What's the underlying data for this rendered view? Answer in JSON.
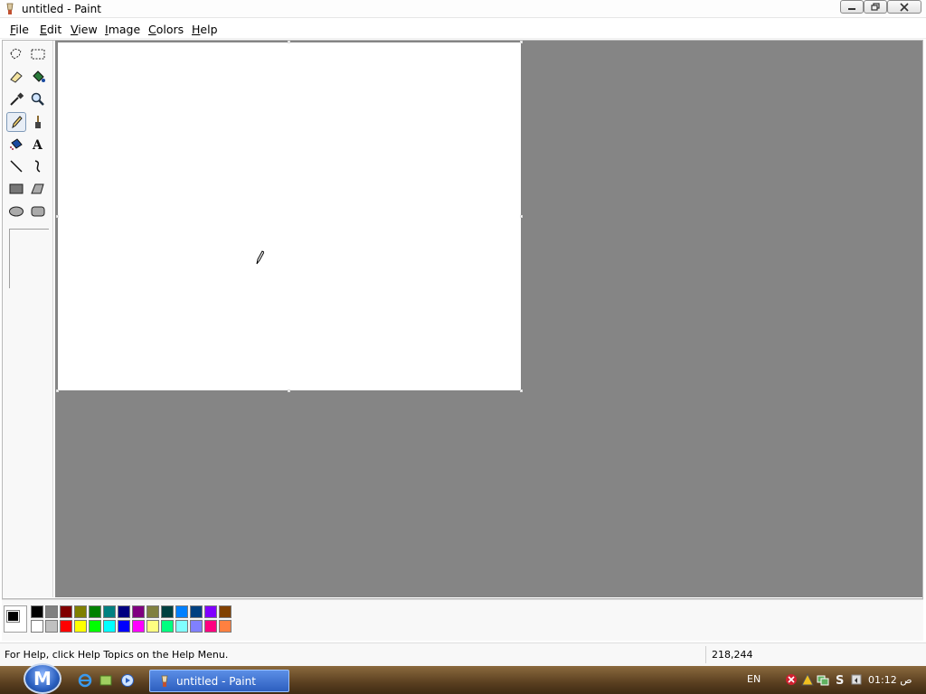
{
  "window": {
    "title": "untitled - Paint",
    "controls": [
      "minimize",
      "maximize",
      "close"
    ]
  },
  "menu": {
    "items": [
      "File",
      "Edit",
      "View",
      "Image",
      "Colors",
      "Help"
    ]
  },
  "toolbox": {
    "tools": [
      {
        "name": "free-form-select-icon"
      },
      {
        "name": "select-icon"
      },
      {
        "name": "eraser-icon"
      },
      {
        "name": "fill-icon"
      },
      {
        "name": "pick-color-icon"
      },
      {
        "name": "magnifier-icon"
      },
      {
        "name": "pencil-icon",
        "active": true
      },
      {
        "name": "brush-icon"
      },
      {
        "name": "airbrush-icon"
      },
      {
        "name": "text-icon"
      },
      {
        "name": "line-icon"
      },
      {
        "name": "curve-icon"
      },
      {
        "name": "rectangle-icon"
      },
      {
        "name": "polygon-icon"
      },
      {
        "name": "ellipse-icon"
      },
      {
        "name": "rounded-rectangle-icon"
      }
    ]
  },
  "palette": {
    "foreground": "#000000",
    "background": "#ffffff",
    "top_row": [
      "#000000",
      "#808080",
      "#800000",
      "#808000",
      "#008000",
      "#008080",
      "#000080",
      "#800080",
      "#808040",
      "#004040",
      "#0080ff",
      "#004080",
      "#8000ff",
      "#804000"
    ],
    "bottom_row": [
      "#ffffff",
      "#c0c0c0",
      "#ff0000",
      "#ffff00",
      "#00ff00",
      "#00ffff",
      "#0000ff",
      "#ff00ff",
      "#ffff80",
      "#00ff80",
      "#80ffff",
      "#8080ff",
      "#ff0080",
      "#ff8040"
    ]
  },
  "status": {
    "help": "For Help, click Help Topics on the Help Menu.",
    "coords": "218,244"
  },
  "taskbar": {
    "start_label": "M",
    "task_label": "untitled - Paint",
    "lang": "EN",
    "clock": "01:12 ص"
  }
}
